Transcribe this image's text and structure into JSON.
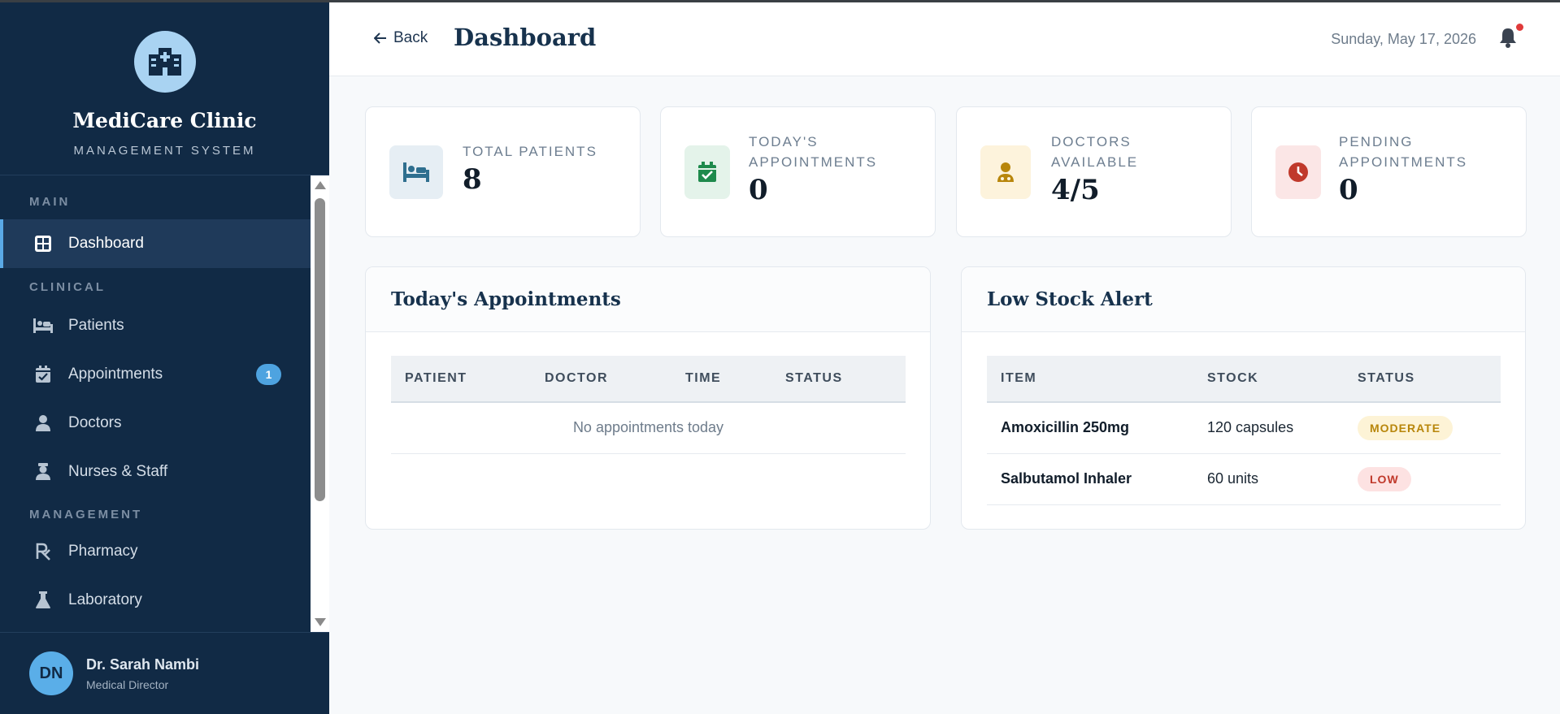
{
  "brand": {
    "name": "MediCare Clinic",
    "subtitle": "MANAGEMENT SYSTEM",
    "logo_icon": "hospital-icon"
  },
  "sidebar": {
    "sections": [
      {
        "label": "MAIN",
        "items": [
          {
            "label": "Dashboard",
            "icon": "grid-icon",
            "active": true
          }
        ]
      },
      {
        "label": "CLINICAL",
        "items": [
          {
            "label": "Patients",
            "icon": "bed-icon"
          },
          {
            "label": "Appointments",
            "icon": "calendar-check-icon",
            "badge": "1"
          },
          {
            "label": "Doctors",
            "icon": "doctor-icon"
          },
          {
            "label": "Nurses & Staff",
            "icon": "nurse-icon"
          }
        ]
      },
      {
        "label": "MANAGEMENT",
        "items": [
          {
            "label": "Pharmacy",
            "icon": "prescription-icon"
          },
          {
            "label": "Laboratory",
            "icon": "flask-icon"
          }
        ]
      }
    ]
  },
  "user": {
    "initials": "DN",
    "name": "Dr. Sarah Nambi",
    "role": "Medical Director"
  },
  "header": {
    "back_label": "Back",
    "title": "Dashboard",
    "date": "Sunday, May 17, 2026",
    "has_notification": true
  },
  "stats": [
    {
      "label": "TOTAL PATIENTS",
      "value": "8",
      "icon": "bed-icon",
      "color": "#2f6f8f",
      "bg": "#e6eef4"
    },
    {
      "label": "TODAY'S APPOINTMENTS",
      "value": "0",
      "icon": "calendar-check-icon",
      "color": "#1e8a4c",
      "bg": "#e4f3ea"
    },
    {
      "label": "DOCTORS AVAILABLE",
      "value": "4/5",
      "icon": "doctor-icon",
      "color": "#b8860b",
      "bg": "#fdf3dc"
    },
    {
      "label": "PENDING APPOINTMENTS",
      "value": "0",
      "icon": "clock-icon",
      "color": "#c0392b",
      "bg": "#fbe6e6"
    }
  ],
  "appointments_panel": {
    "title": "Today's Appointments",
    "columns": [
      "PATIENT",
      "DOCTOR",
      "TIME",
      "STATUS"
    ],
    "empty_message": "No appointments today"
  },
  "stock_panel": {
    "title": "Low Stock Alert",
    "columns": [
      "ITEM",
      "STOCK",
      "STATUS"
    ],
    "rows": [
      {
        "item": "Amoxicillin 250mg",
        "stock": "120 capsules",
        "status": "MODERATE"
      },
      {
        "item": "Salbutamol Inhaler",
        "stock": "60 units",
        "status": "LOW"
      }
    ]
  }
}
